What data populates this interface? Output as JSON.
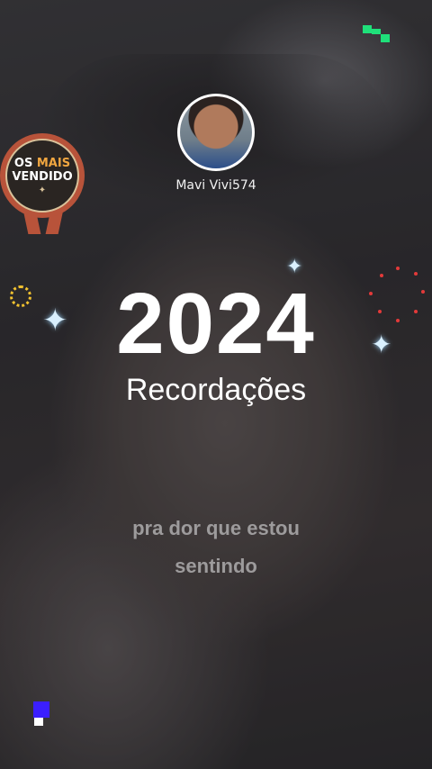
{
  "profile": {
    "username": "Mavi Vivi574"
  },
  "badge": {
    "word_os": "OS",
    "word_mais": "MAIS",
    "word_vendido": "VENDIDO"
  },
  "title": {
    "year": "2024",
    "subtitle": "Recordações"
  },
  "caption": {
    "line1": "pra dor que estou",
    "line2": "sentindo"
  },
  "colors": {
    "accent_gold": "#f0a640",
    "badge_red": "#b8533a",
    "dot_red": "#e33a3a",
    "pixel_green": "#1fe07a",
    "pixel_blue": "#3b1fff"
  },
  "icons": {
    "sparkle": "four-point-star",
    "sun": "dotted-circle"
  }
}
